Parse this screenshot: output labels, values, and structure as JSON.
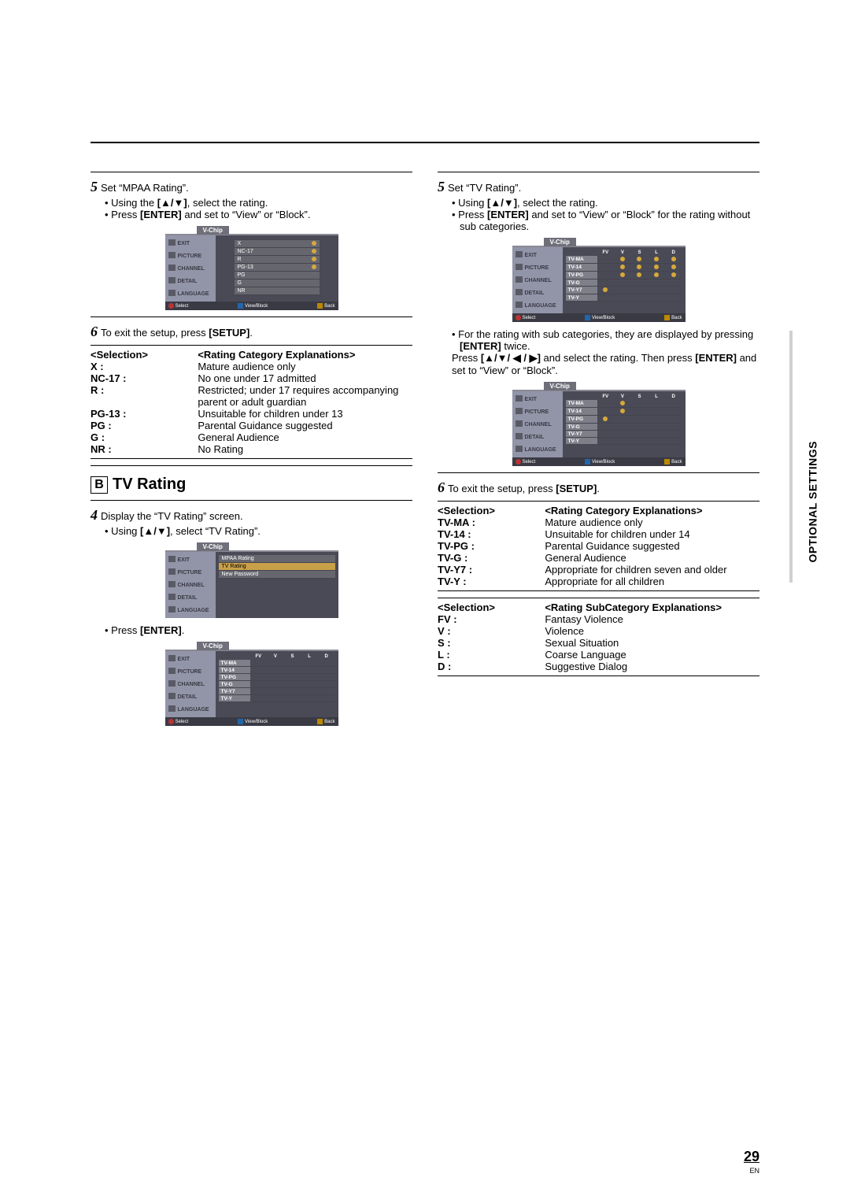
{
  "pageNumber": "29",
  "enLabel": "EN",
  "verticalLabel": "OPTIONAL SETTINGS",
  "left": {
    "step5": {
      "num": "5",
      "text": "Set “MPAA Rating”.",
      "bullet1_a": "Using the ",
      "bullet1_keys": "[▲/▼]",
      "bullet1_b": ", select the rating.",
      "bullet2_a": "Press ",
      "bullet2_key": "[ENTER]",
      "bullet2_b": " and set to “View” or “Block”."
    },
    "step6": {
      "num": "6",
      "text_a": "To exit the setup, press ",
      "text_key": "[SETUP]",
      "text_b": "."
    },
    "mpaaTable": {
      "headerLeft": "<Selection>",
      "headerRight": "<Rating Category Explanations>",
      "rows": [
        {
          "k": "X :",
          "v": "Mature audience only"
        },
        {
          "k": "NC-17 :",
          "v": "No one under 17 admitted"
        },
        {
          "k": "R :",
          "v": "Restricted; under 17 requires accompanying parent or adult guardian"
        },
        {
          "k": "PG-13 :",
          "v": "Unsuitable for children under 13"
        },
        {
          "k": "PG :",
          "v": "Parental Guidance suggested"
        },
        {
          "k": "G :",
          "v": "General Audience"
        },
        {
          "k": "NR :",
          "v": "No Rating"
        }
      ]
    },
    "sectionBTitle": "TV Rating",
    "sectionBLetter": "B",
    "step4": {
      "num": "4",
      "text": "Display the “TV Rating” screen.",
      "bullet1_a": "Using ",
      "bullet1_key": "[▲/▼]",
      "bullet1_b": ", select “TV Rating”.",
      "bullet2_a": "Press ",
      "bullet2_key": "[ENTER]",
      "bullet2_b": "."
    }
  },
  "right": {
    "step5": {
      "num": "5",
      "text": "Set “TV Rating”.",
      "bullet1_a": "Using ",
      "bullet1_key": "[▲/▼]",
      "bullet1_b": ", select the rating.",
      "bullet2_a": "Press ",
      "bullet2_key": "[ENTER]",
      "bullet2_b": " and set to “View” or “Block” for the rating without sub categories.",
      "bullet3_a": "For the rating with sub categories, they are displayed by pressing ",
      "bullet3_key1": "[ENTER]",
      "bullet3_b": " twice.",
      "line4_a": "Press ",
      "line4_key": "[▲/▼/ ◀ / ▶]",
      "line4_b": " and select the rating. Then press ",
      "line4_key2": "[ENTER]",
      "line4_c": " and set to “View” or “Block”."
    },
    "step6": {
      "num": "6",
      "text_a": "To exit the setup, press ",
      "text_key": "[SETUP]",
      "text_b": "."
    },
    "tvTable1": {
      "headerLeft": "<Selection>",
      "headerRight": "<Rating Category Explanations>",
      "rows": [
        {
          "k": "TV-MA :",
          "v": "Mature audience only"
        },
        {
          "k": "TV-14 :",
          "v": "Unsuitable for children under 14"
        },
        {
          "k": "TV-PG :",
          "v": "Parental Guidance suggested"
        },
        {
          "k": "TV-G :",
          "v": "General Audience"
        },
        {
          "k": "TV-Y7 :",
          "v": "Appropriate for children seven and older"
        },
        {
          "k": "TV-Y :",
          "v": "Appropriate for all children"
        }
      ]
    },
    "tvTable2": {
      "headerLeft": "<Selection>",
      "headerRight": "<Rating SubCategory Explanations>",
      "rows": [
        {
          "k": "FV :",
          "v": "Fantasy Violence"
        },
        {
          "k": "V :",
          "v": "Violence"
        },
        {
          "k": "S :",
          "v": "Sexual Situation"
        },
        {
          "k": "L :",
          "v": "Coarse Language"
        },
        {
          "k": "D :",
          "v": "Suggestive Dialog"
        }
      ]
    }
  },
  "osd": {
    "tab": "V-Chip",
    "side": [
      "EXIT",
      "PICTURE",
      "CHANNEL",
      "DETAIL",
      "LANGUAGE"
    ],
    "footerSelect": "Select",
    "footerViewBlock": "View/Block",
    "footerBack": "Back",
    "mpaaRows": [
      "X",
      "NC-17",
      "R",
      "PG-13",
      "PG",
      "G",
      "NR"
    ],
    "menu2": [
      "MPAA Rating",
      "TV Rating",
      "New Password"
    ],
    "tvCols": [
      "FV",
      "V",
      "S",
      "L",
      "D"
    ],
    "tvRows": [
      "TV-MA",
      "TV-14",
      "TV-PG",
      "TV-G",
      "TV-Y7",
      "TV-Y"
    ]
  }
}
